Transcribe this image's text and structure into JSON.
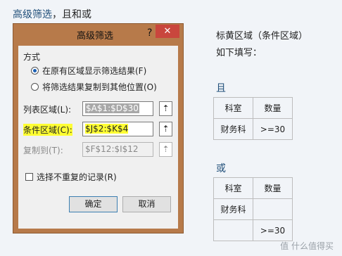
{
  "page_title": {
    "main": "高级筛选",
    "rest": "，且和或"
  },
  "dialog": {
    "title": "高级筛选",
    "help": "?",
    "close": "✕",
    "group_label": "方式",
    "option1": "在原有区域显示筛选结果(F)",
    "option2": "将筛选结果复制到其他位置(O)",
    "list_range_label": "列表区域(L):",
    "list_range_value": "$A$1:$D$30",
    "criteria_label": "条件区域(C):",
    "criteria_value": "$J$2:$K$4",
    "copy_to_label": "复制到(T):",
    "copy_to_value": "$F$12:$I$12",
    "pick_icon": "⇡",
    "unique_label": "选择不重复的记录(R)",
    "ok": "确定",
    "cancel": "取消"
  },
  "right": {
    "note_line1": "标黄区域（条件区域）",
    "note_line2": "如下填写：",
    "and_title": "且",
    "and_table": [
      [
        "科室",
        "数量"
      ],
      [
        "财务科",
        ">=30"
      ]
    ],
    "or_title": "或",
    "or_table": [
      [
        "科室",
        "数量"
      ],
      [
        "财务科",
        ""
      ],
      [
        "",
        ">=30"
      ]
    ]
  },
  "watermark": "值 什么值得买"
}
